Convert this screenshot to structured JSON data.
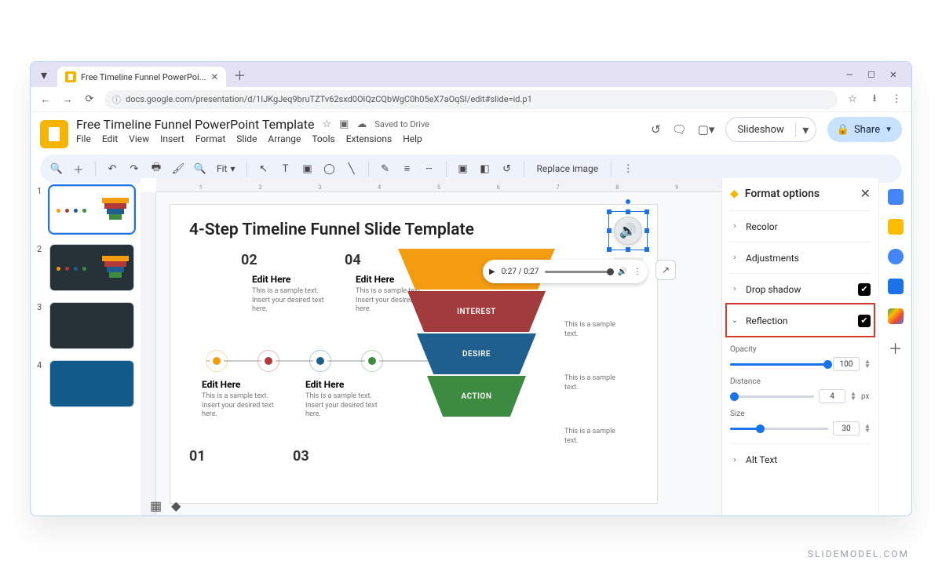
{
  "browser": {
    "tab_title": "Free Timeline Funnel PowerPoi...",
    "url": "docs.google.com/presentation/d/1IJKgJeq9bruTZTv62sxd0OlQzCQbWgC0h05eX7aOqSI/edit#slide=id.p1"
  },
  "header": {
    "doc_title": "Free Timeline Funnel PowerPoint Template",
    "save_state": "Saved to Drive",
    "menus": [
      "File",
      "Edit",
      "View",
      "Insert",
      "Format",
      "Slide",
      "Arrange",
      "Tools",
      "Extensions",
      "Help"
    ],
    "slideshow": "Slideshow",
    "share": "Share"
  },
  "toolbar": {
    "zoom": "Fit",
    "replace_image": "Replace image"
  },
  "ruler_ticks": [
    "",
    "1",
    "",
    "2",
    "",
    "3",
    "",
    "4",
    "",
    "5",
    "",
    "6",
    "",
    "7",
    "",
    "8",
    "",
    "9",
    ""
  ],
  "thumbs": [
    1,
    2,
    3,
    4
  ],
  "slide": {
    "title": "4-Step Timeline Funnel Slide Template",
    "numbers": {
      "n1": "01",
      "n2": "02",
      "n3": "03",
      "n4": "04"
    },
    "edit_label": "Edit Here",
    "edit_body": "This is a sample text. Insert your desired text here.",
    "funnel": {
      "s1": "",
      "s2": "INTEREST",
      "s3": "DESIRE",
      "s4": "ACTION"
    },
    "side_text": "This is a sample text."
  },
  "audio": {
    "time": "0:27 / 0:27"
  },
  "format": {
    "title": "Format options",
    "recolor": "Recolor",
    "adjustments": "Adjustments",
    "drop_shadow": "Drop shadow",
    "reflection": "Reflection",
    "alt_text": "Alt Text",
    "opacity": {
      "label": "Opacity",
      "value": "100",
      "pct": 100
    },
    "distance": {
      "label": "Distance",
      "value": "4",
      "unit": "px",
      "pct": 5
    },
    "size": {
      "label": "Size",
      "value": "30",
      "pct": 30
    }
  },
  "watermark": "SLIDEMODEL.COM"
}
